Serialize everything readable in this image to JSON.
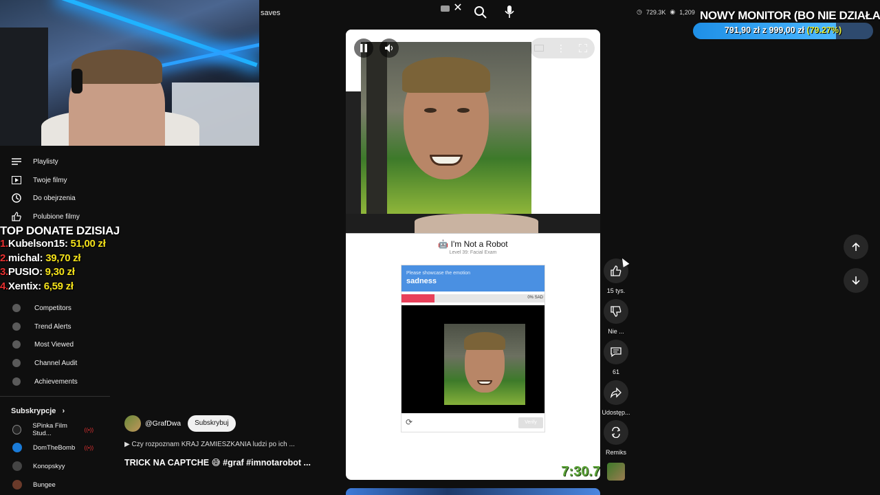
{
  "search": {
    "query": "saves"
  },
  "stats": {
    "views": "729.3K",
    "secondary": "1,209"
  },
  "goal": {
    "title": "NOWY MONITOR (BO NIE DZIAŁA)",
    "current": "791,90 zł",
    "separator": "z",
    "target": "999,00 zł",
    "percent_text": "(79.27%)",
    "percent": 79.27
  },
  "sidebar": {
    "items": [
      {
        "label": "Playlisty",
        "icon": "playlist-icon"
      },
      {
        "label": "Twoje filmy",
        "icon": "video-icon"
      },
      {
        "label": "Do obejrzenia",
        "icon": "clock-icon"
      },
      {
        "label": "Polubione filmy",
        "icon": "thumbs-up-icon"
      }
    ],
    "tools": [
      {
        "label": "Competitors"
      },
      {
        "label": "Trend Alerts"
      },
      {
        "label": "Most Viewed"
      },
      {
        "label": "Channel Audit"
      },
      {
        "label": "Achievements"
      }
    ],
    "subs_heading": "Subskrypcje",
    "subs": [
      {
        "label": "SPinka Film Stud...",
        "color": "#222222",
        "live": true
      },
      {
        "label": "DomTheBomb",
        "color": "#1a7bd8",
        "live": true
      },
      {
        "label": "Konopskyy",
        "color": "#444444",
        "live": false
      },
      {
        "label": "Bungee",
        "color": "#6a3a2a",
        "live": false
      }
    ]
  },
  "donate": {
    "title": "TOP DONATE DZISIAJ",
    "rows": [
      {
        "rank": "1.",
        "name": "Kubelson15:",
        "amount": "51,00 zł"
      },
      {
        "rank": "2.",
        "name": "michal:",
        "amount": "39,70 zł"
      },
      {
        "rank": "3.",
        "name": "PUSIO:",
        "amount": "9,30 zł"
      },
      {
        "rank": "4.",
        "name": "Xentix:",
        "amount": "6,59 zł"
      }
    ]
  },
  "game": {
    "title": "I'm Not a Robot",
    "subtitle": "Level 39: Facial Exam",
    "prompt": "Please showcase the emotion",
    "emotion": "sadness",
    "progress_text": "0% SAD",
    "progress": 0.23,
    "verify_label": "Verify",
    "timer": "7:30.7"
  },
  "actions": {
    "like_count": "15 tys.",
    "dislike_label": "Nie ...",
    "comments_count": "61",
    "share_label": "Udostęp...",
    "remix_label": "Remiks"
  },
  "channel": {
    "handle": "@GrafDwa",
    "subscribe_label": "Subskrybuj"
  },
  "related": {
    "text": "Czy rozpoznam KRAJ ZAMIESZKANIA ludzi po ich ..."
  },
  "short": {
    "title": "TRICK NA CAPTCHE 😅 #graf #imnotarobot ..."
  }
}
